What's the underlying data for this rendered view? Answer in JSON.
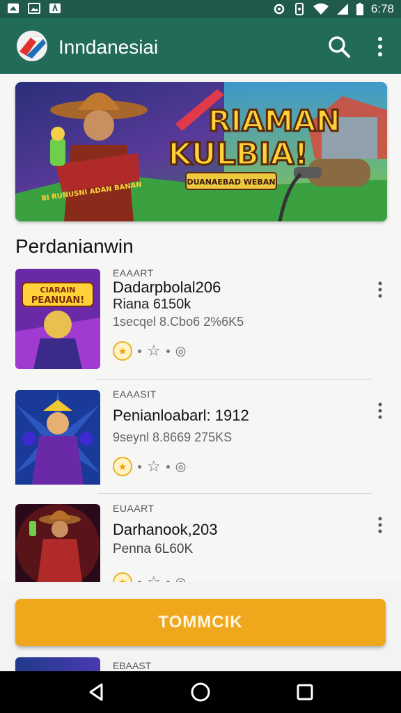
{
  "app": {
    "title": "Inndanesiai",
    "accent": "#216b58",
    "cta_color": "#efa81c"
  },
  "status_bar": {
    "time": "6:78",
    "icons": [
      "notification-icon",
      "image-icon",
      "app-icon",
      "sync-icon",
      "vibrate-icon",
      "wifi-icon",
      "signal-icon",
      "battery-icon"
    ]
  },
  "toolbar": {
    "search_icon": "search-icon",
    "menu_icon": "more-vert-icon"
  },
  "banner": {
    "title_line1": "RIAMAN",
    "title_line2": "KULBIA!",
    "ribbon_text": "BI RUNUSNI ADAN BANAN",
    "sign_text": "DUANAEBAD WEBAN"
  },
  "section": {
    "title": "Perdanianwin"
  },
  "items": [
    {
      "tag": "EAAART",
      "name": "Dadarpbolal206",
      "subtitle": "Riana 6150k",
      "meta": "1secqel 8.Cbo6 2%6K5",
      "thumb_title1": "CIARAIN",
      "thumb_title2": "PEANUAN!"
    },
    {
      "tag": "EAAASIT",
      "name": "Penianloabarl: 1912",
      "subtitle": "",
      "meta": "9seynl 8.8669 275KS"
    },
    {
      "tag": "EUAART",
      "name": "Darhanook,203",
      "subtitle": "Penna 6L60K",
      "meta": ""
    }
  ],
  "cta": {
    "label": "TOMMCIK"
  },
  "peek": {
    "tag": "EBAAST"
  }
}
